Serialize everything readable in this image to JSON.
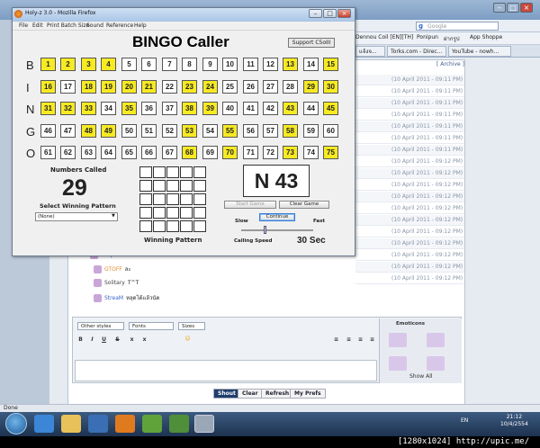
{
  "browser": {
    "window_title": "Holy-z 3.0 - Mozilla Firefox",
    "search_placeholder": "Google",
    "bookmarks": [
      "Dennou Coil [EN][TH]",
      "Ponipun",
      "ฝากรูป",
      "App Shoppe"
    ],
    "tabs": [
      "แจ้งจ...",
      "Torks.com - Direc...",
      "YouTube - nowh..."
    ],
    "status": "Done",
    "archive_link": "[ Archive ]",
    "chat_timestamps": [
      "(10 April 2011 - 09:11 PM)",
      "(10 April 2011 - 09:11 PM)",
      "(10 April 2011 - 09:11 PM)",
      "(10 April 2011 - 09:11 PM)",
      "(10 April 2011 - 09:11 PM)",
      "(10 April 2011 - 09:11 PM)",
      "(10 April 2011 - 09:11 PM)",
      "(10 April 2011 - 09:12 PM)",
      "(10 April 2011 - 09:12 PM)",
      "(10 April 2011 - 09:12 PM)",
      "(10 April 2011 - 09:12 PM)",
      "(10 April 2011 - 09:12 PM)",
      "(10 April 2011 - 09:12 PM)",
      "(10 April 2011 - 09:12 PM)",
      "(10 April 2011 - 09:12 PM)",
      "(10 April 2011 - 09:12 PM)",
      "(10 April 2011 - 09:12 PM)",
      "(10 April 2011 - 09:12 PM)"
    ],
    "chat_messages": [
      {
        "name": "Sleipner",
        "text": "หน้"
      },
      {
        "name": "GTOFF",
        "text": "ละ"
      },
      {
        "name": "Solitary",
        "text": "T^T"
      },
      {
        "name": "StreaM",
        "text": "หลุดได้แล้วนัด"
      }
    ],
    "editor": {
      "styles": "Other styles",
      "fonts": "Fonts",
      "sizes": "Sizes"
    },
    "emoticons_title": "Emoticons",
    "show_all": "Show All",
    "post_buttons": [
      "Shout",
      "Clear",
      "Refresh",
      "My Prefs"
    ],
    "taskbar": {
      "lang": "EN",
      "time": "21:12",
      "date": "10/4/2554"
    },
    "watermark": "[1280x1024] http://upic.me/"
  },
  "bingo": {
    "menu": [
      "File",
      "Edit",
      "Print Batch Size",
      "Sound",
      "Reference",
      "Help"
    ],
    "title": "BINGO Caller",
    "support_label": "Support C5oIII",
    "letters": [
      "B",
      "I",
      "N",
      "G",
      "O"
    ],
    "rows": [
      {
        "letter": "B",
        "start": 1,
        "called": [
          1,
          2,
          3,
          4,
          13,
          15
        ]
      },
      {
        "letter": "I",
        "start": 16,
        "called": [
          16,
          18,
          19,
          20,
          21,
          23,
          24,
          29,
          30
        ]
      },
      {
        "letter": "N",
        "start": 31,
        "called": [
          31,
          32,
          33,
          35,
          38,
          39,
          43,
          45
        ]
      },
      {
        "letter": "G",
        "start": 46,
        "called": [
          48,
          49,
          53,
          55,
          58
        ]
      },
      {
        "letter": "O",
        "start": 61,
        "called": [
          68,
          70,
          73,
          75
        ]
      }
    ],
    "numbers_called_label": "Numbers Called",
    "numbers_called_value": "29",
    "select_pattern_label": "Select Winning Pattern",
    "pattern_value": "(None)",
    "winning_pattern_label": "Winning Pattern",
    "current_call": "N 43",
    "start_game_label": "Start Game",
    "clear_game_label": "Clear Game",
    "continue_label": "Continue",
    "slow_label": "Slow",
    "fast_label": "Fast",
    "calling_speed_label": "Calling Speed",
    "speed_value": "30 Sec"
  }
}
